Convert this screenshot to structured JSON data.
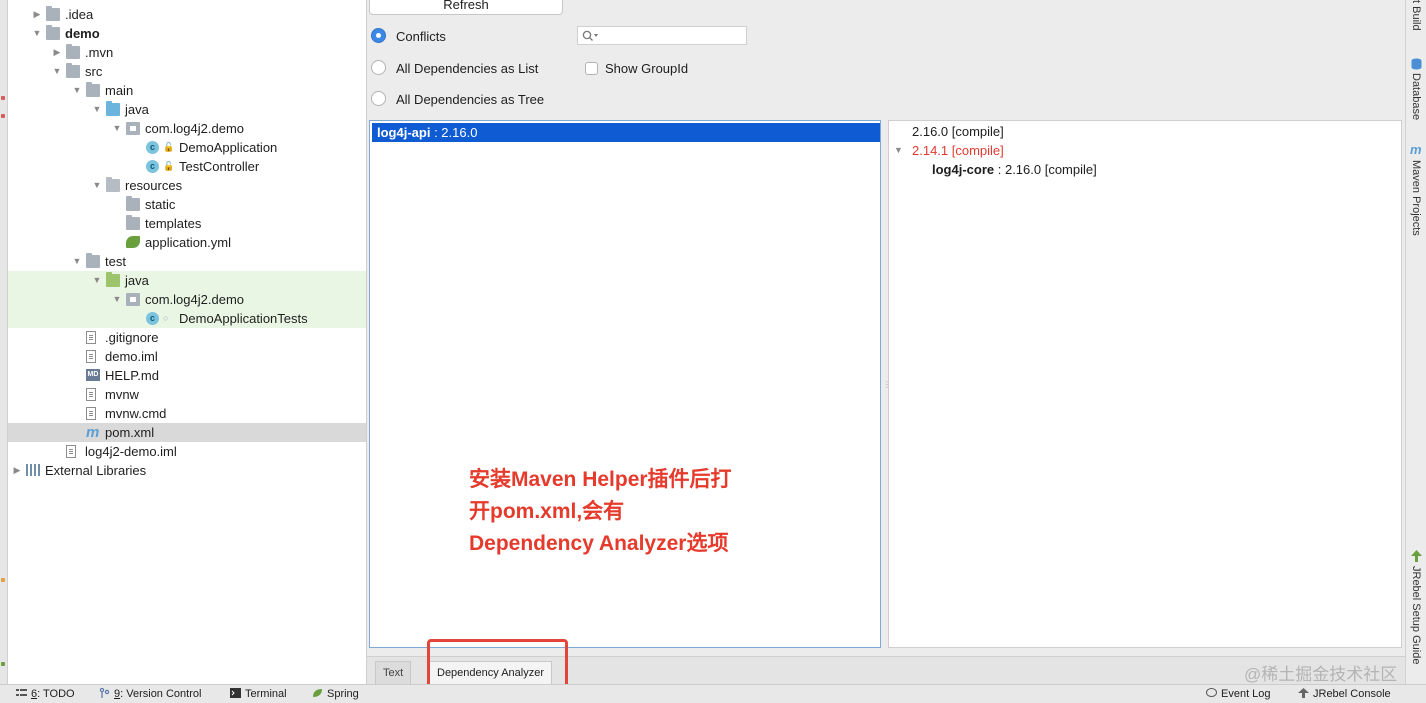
{
  "project_tree": {
    "rows": [
      {
        "label": ".idea",
        "depth": 1,
        "expanded": false,
        "icon": "folder-icon"
      },
      {
        "label": "demo",
        "depth": 1,
        "expanded": true,
        "icon": "module-folder-icon",
        "bold": true
      },
      {
        "label": ".mvn",
        "depth": 2,
        "expanded": false,
        "icon": "folder-icon"
      },
      {
        "label": "src",
        "depth": 2,
        "expanded": true,
        "icon": "folder-icon"
      },
      {
        "label": "main",
        "depth": 3,
        "expanded": true,
        "icon": "folder-icon"
      },
      {
        "label": "java",
        "depth": 4,
        "expanded": true,
        "icon": "source-folder-icon"
      },
      {
        "label": "com.log4j2.demo",
        "depth": 5,
        "expanded": true,
        "icon": "package-icon"
      },
      {
        "label": "DemoApplication",
        "depth": 6,
        "icon": "spring-class-icon"
      },
      {
        "label": "TestController",
        "depth": 6,
        "icon": "class-icon"
      },
      {
        "label": "resources",
        "depth": 4,
        "expanded": true,
        "icon": "resources-folder-icon"
      },
      {
        "label": "static",
        "depth": 5,
        "icon": "folder-icon"
      },
      {
        "label": "templates",
        "depth": 5,
        "icon": "folder-icon"
      },
      {
        "label": "application.yml",
        "depth": 5,
        "icon": "yml-file-icon"
      },
      {
        "label": "test",
        "depth": 3,
        "expanded": true,
        "icon": "folder-icon"
      },
      {
        "label": "java",
        "depth": 4,
        "expanded": true,
        "icon": "test-folder-icon",
        "test": true
      },
      {
        "label": "com.log4j2.demo",
        "depth": 5,
        "expanded": true,
        "icon": "package-icon",
        "test": true
      },
      {
        "label": "DemoApplicationTests",
        "depth": 6,
        "icon": "test-class-icon",
        "test": true
      },
      {
        "label": ".gitignore",
        "depth": 3,
        "icon": "text-file-icon"
      },
      {
        "label": "demo.iml",
        "depth": 3,
        "icon": "iml-file-icon"
      },
      {
        "label": "HELP.md",
        "depth": 3,
        "icon": "markdown-file-icon"
      },
      {
        "label": "mvnw",
        "depth": 3,
        "icon": "text-file-icon"
      },
      {
        "label": "mvnw.cmd",
        "depth": 3,
        "icon": "text-file-icon"
      },
      {
        "label": "pom.xml",
        "depth": 3,
        "icon": "maven-file-icon",
        "selected": true
      },
      {
        "label": "log4j2-demo.iml",
        "depth": 2,
        "icon": "iml-file-icon"
      },
      {
        "label": "External Libraries",
        "depth": 0,
        "expanded": false,
        "icon": "libraries-icon"
      }
    ]
  },
  "analyzer": {
    "refresh_label": "Refresh",
    "radio_conflicts": "Conflicts",
    "radio_list": "All Dependencies as List",
    "radio_tree": "All Dependencies as Tree",
    "show_groupid": "Show GroupId",
    "search_value": "",
    "conflict_item": {
      "artifact": "log4j-api",
      "version": " : 2.16.0"
    },
    "tree_rows": [
      {
        "text": "2.16.0 [compile]",
        "conflict": false
      },
      {
        "text": "2.14.1 [compile]",
        "conflict": true
      },
      {
        "artifact": "log4j-core",
        "text": " : 2.16.0 [compile]"
      }
    ],
    "tabs": [
      "Text",
      "Dependency Analyzer"
    ]
  },
  "annotation": {
    "line1": "安装Maven Helper插件后打",
    "line2": "开pom.xml,会有",
    "line3": "Dependency Analyzer选项"
  },
  "right_toolbar": {
    "build": "t Build",
    "database": "Database",
    "maven": "Maven Projects",
    "jrebel": "JRebel Setup Guide"
  },
  "status_bar": {
    "todo_num": "6",
    "todo": ": TODO",
    "vc_num": "9",
    "vc": ": Version Control",
    "terminal": "Terminal",
    "spring": "Spring",
    "event_log": "Event Log",
    "jrebel_console": "JRebel Console"
  },
  "watermark": "@稀土掘金技术社区",
  "colors": {
    "accent": "#0f5bd4",
    "conflict": "#e03a2f",
    "annotation": "#e53a2c"
  }
}
